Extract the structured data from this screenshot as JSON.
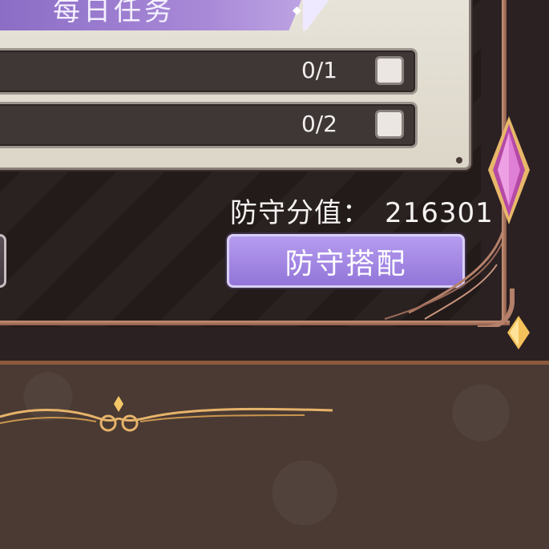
{
  "daily_tasks": {
    "title": "每日任务",
    "tasks": [
      {
        "progress": "0/1"
      },
      {
        "progress": "0/2"
      }
    ]
  },
  "defense": {
    "score_label": "防守分值：",
    "score_value": "216301",
    "setup_button_label": "防守搭配"
  },
  "colors": {
    "accent_purple": "#9f84e0",
    "frame_copper": "#b5806a",
    "gem_pink": "#d46fc9",
    "gem_gold": "#f0b24a"
  }
}
